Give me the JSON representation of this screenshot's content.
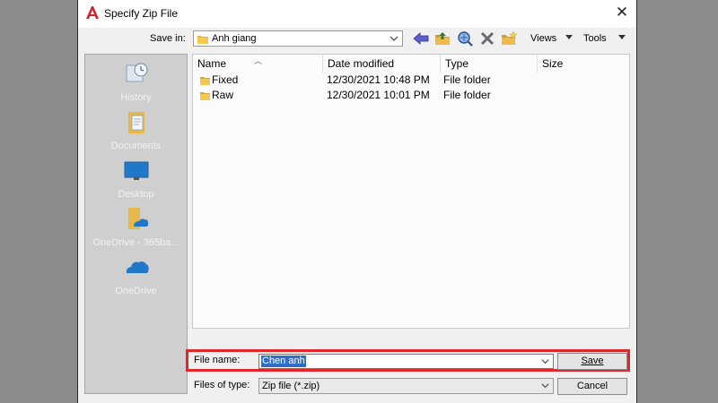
{
  "window": {
    "title": "Specify Zip File",
    "close_glyph": "✕"
  },
  "toolbar": {
    "save_in_label": "Save in:",
    "save_in_value": "Anh giang",
    "views_label": "Views",
    "tools_label": "Tools",
    "icons": [
      "back-icon",
      "up-folder-icon",
      "search-web-icon",
      "delete-icon",
      "new-folder-icon"
    ]
  },
  "places": [
    {
      "label": "History",
      "icon": "history-icon"
    },
    {
      "label": "Documents",
      "icon": "documents-icon"
    },
    {
      "label": "Desktop",
      "icon": "desktop-icon"
    },
    {
      "label": "OneDrive - 365ba...",
      "icon": "onedrive-folder-icon"
    },
    {
      "label": "OneDrive",
      "icon": "onedrive-cloud-icon"
    }
  ],
  "columns": [
    "Name",
    "Date modified",
    "Type",
    "Size"
  ],
  "files": [
    {
      "name": "Fixed",
      "date": "12/30/2021 10:48 PM",
      "type": "File folder",
      "size": ""
    },
    {
      "name": "Raw",
      "date": "12/30/2021 10:01 PM",
      "type": "File folder",
      "size": ""
    }
  ],
  "form": {
    "file_name_label": "File name:",
    "file_name_value": "Chen anh",
    "files_of_type_label": "Files of type:",
    "files_of_type_value": "Zip file (*.zip)",
    "save_label": "Save",
    "cancel_label": "Cancel"
  },
  "colors": {
    "highlight_frame": "#e3262a",
    "selection": "#2f6fc9",
    "app_logo": "#d2232a"
  }
}
